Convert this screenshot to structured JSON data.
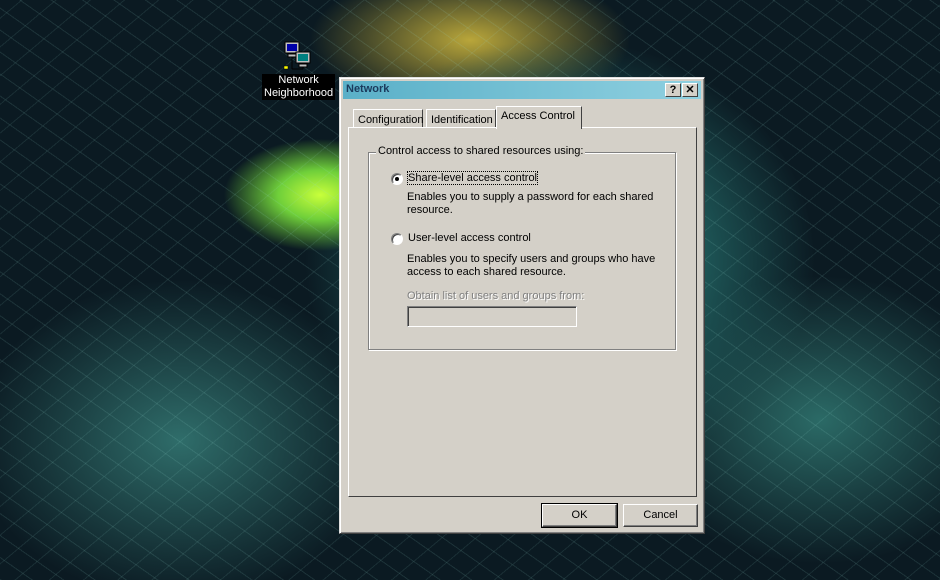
{
  "desktop": {
    "icon_name": "network-neighborhood-icon",
    "icon_label_line1": "Network",
    "icon_label_line2": "Neighborhood"
  },
  "dialog": {
    "title": "Network",
    "help_button": "?",
    "close_button": "✕",
    "tabs": [
      {
        "label": "Configuration",
        "active": false
      },
      {
        "label": "Identification",
        "active": false
      },
      {
        "label": "Access Control",
        "active": true
      }
    ],
    "group": {
      "legend": "Control access to shared resources using:",
      "options": [
        {
          "label": "Share-level access control",
          "description": "Enables you to supply a password for each shared resource.",
          "selected": true
        },
        {
          "label": "User-level access control",
          "description": "Enables you to specify users and groups who have access to each shared resource.",
          "selected": false
        }
      ],
      "obtain_list_label": "Obtain list of users and groups from:",
      "obtain_list_value": ""
    },
    "buttons": {
      "ok": "OK",
      "cancel": "Cancel"
    }
  }
}
